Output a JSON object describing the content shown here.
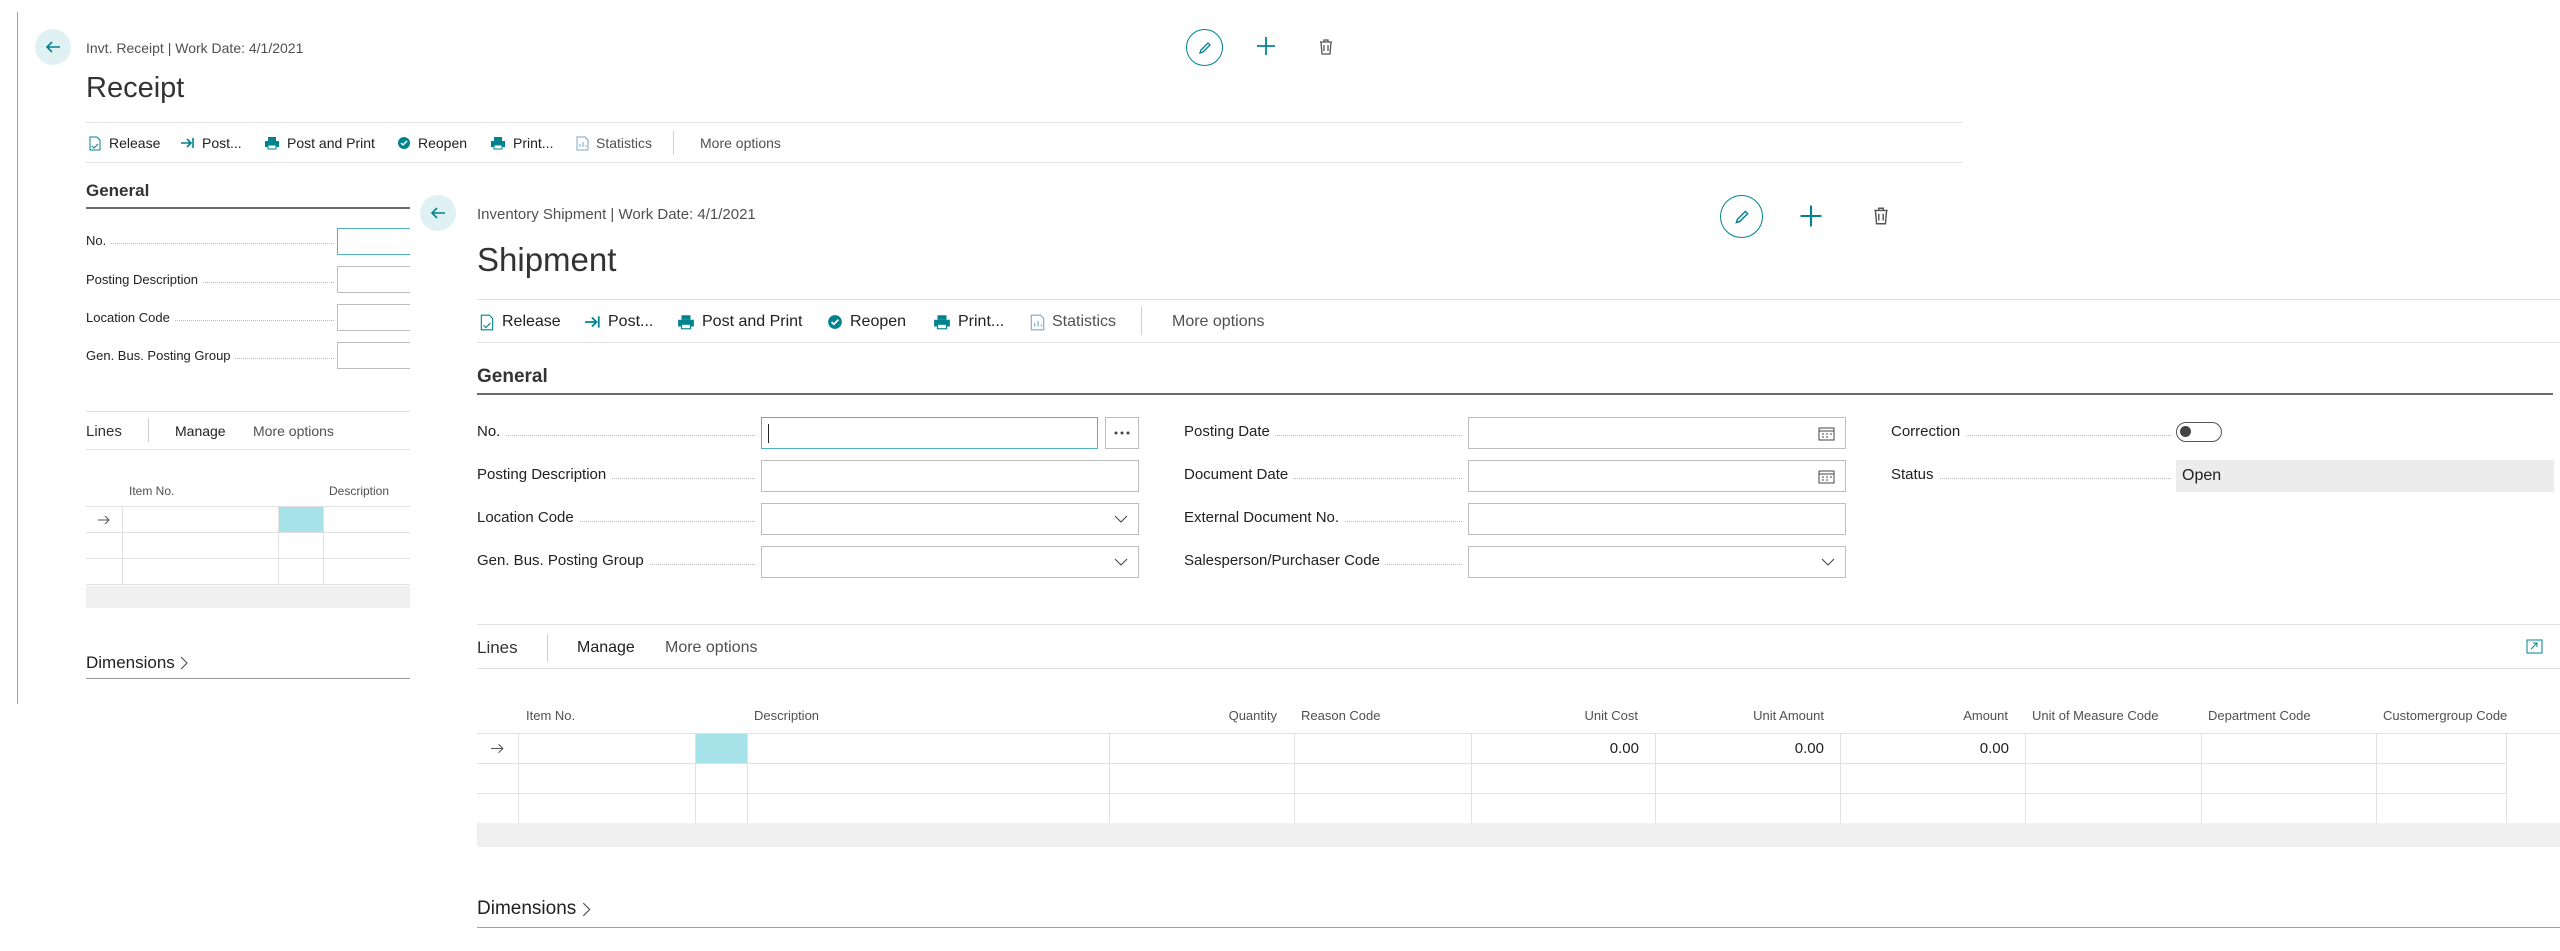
{
  "receipt": {
    "breadcrumb": "Invt. Receipt | Work Date: 4/1/2021",
    "title": "Receipt",
    "actions": [
      "Release",
      "Post...",
      "Post and Print",
      "Reopen",
      "Print...",
      "Statistics",
      "More options"
    ],
    "general_heading": "General",
    "fields": [
      "No.",
      "Posting Description",
      "Location Code",
      "Gen. Bus. Posting Group"
    ],
    "lines": {
      "title": "Lines",
      "manage": "Manage",
      "more_options": "More options",
      "col_item_no": "Item No.",
      "col_description": "Description"
    },
    "dimensions_heading": "Dimensions"
  },
  "shipment": {
    "breadcrumb": "Inventory Shipment | Work Date: 4/1/2021",
    "title": "Shipment",
    "actions": [
      "Release",
      "Post...",
      "Post and Print",
      "Reopen",
      "Print...",
      "Statistics",
      "More options"
    ],
    "general_heading": "General",
    "col1_labels": [
      "No.",
      "Posting Description",
      "Location Code",
      "Gen. Bus. Posting Group"
    ],
    "col2_labels": [
      "Posting Date",
      "Document Date",
      "External Document No.",
      "Salesperson/Purchaser Code"
    ],
    "correction_label": "Correction",
    "status_label": "Status",
    "status_value": "Open",
    "lines": {
      "title": "Lines",
      "manage": "Manage",
      "more_options": "More options",
      "columns": [
        "Item No.",
        "Description",
        "Quantity",
        "Reason Code",
        "Unit Cost",
        "Unit Amount",
        "Amount",
        "Unit of Measure Code",
        "Department Code",
        "Customergroup Code"
      ],
      "row1": {
        "unit_cost": "0.00",
        "unit_amount": "0.00",
        "amount": "0.00"
      }
    },
    "dimensions_heading": "Dimensions"
  },
  "colors": {
    "accent": "#00838f",
    "selection": "#a6e3e8",
    "status_bg": "#ececec",
    "focus_border": "#4fb3bf"
  }
}
